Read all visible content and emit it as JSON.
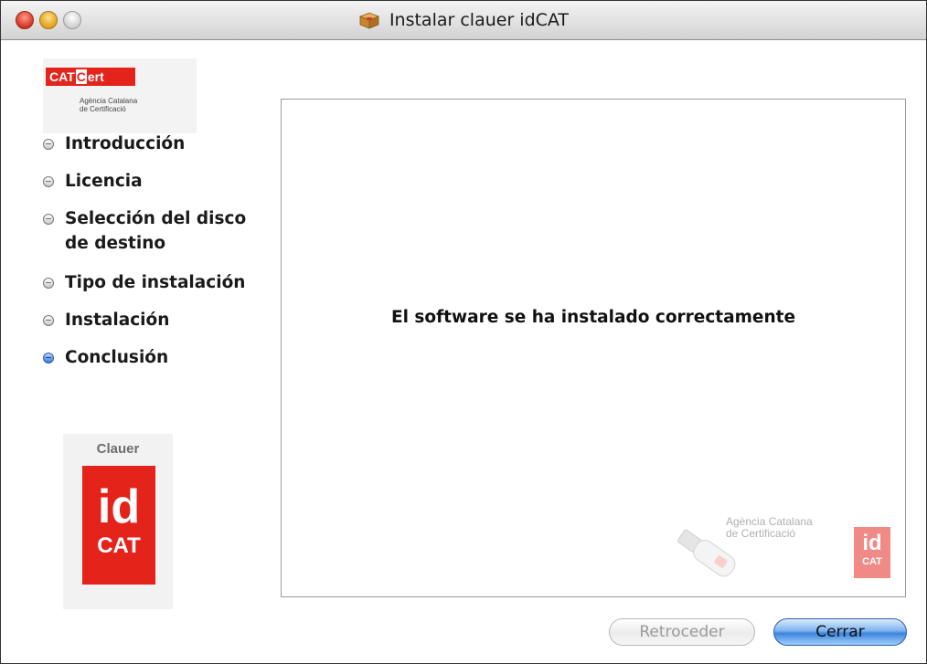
{
  "window": {
    "title": "Instalar clauer idCAT"
  },
  "logos": {
    "catcert": {
      "brand_prefix": "CAT",
      "brand_c": "C",
      "brand_suffix": "ert",
      "sub_line1": "Agència Catalana",
      "sub_line2": "de Certificació"
    },
    "clauer": {
      "label": "Clauer",
      "id_text": "id",
      "cat_text": "CAT"
    }
  },
  "sidebar": {
    "steps": [
      {
        "label": "Introducción"
      },
      {
        "label": "Licencia"
      },
      {
        "label": "Selección del disco de destino",
        "line1": "Selección del disco",
        "line2": "de destino"
      },
      {
        "label": "Tipo de instalación"
      },
      {
        "label": "Instalación"
      },
      {
        "label": "Conclusión"
      }
    ]
  },
  "main": {
    "message": "El software se ha instalado correctamente",
    "watermark": {
      "line1": "Agència Catalana",
      "line2": "de Certificació",
      "id_text": "id",
      "cat_text": "CAT"
    }
  },
  "buttons": {
    "back_label": "Retroceder",
    "close_label": "Cerrar"
  },
  "colors": {
    "brand_red": "#e4231b",
    "active_step_bullet": "#3a79d8",
    "default_button": "#3d84dc"
  }
}
